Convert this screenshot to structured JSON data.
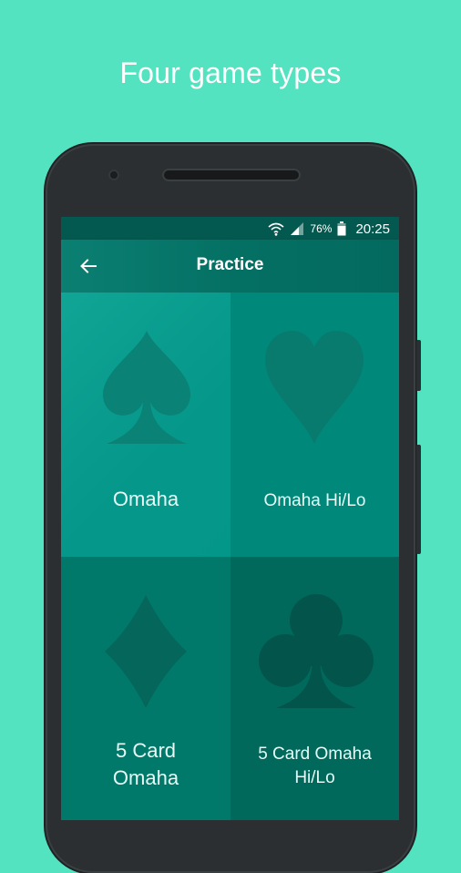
{
  "promo": {
    "headline": "Four game types"
  },
  "status_bar": {
    "battery_percent": "76%",
    "time": "20:25",
    "icons": [
      "wifi-icon",
      "cell-signal-icon",
      "battery-icon"
    ]
  },
  "app_bar": {
    "title": "Practice",
    "back_icon": "arrow-left-icon"
  },
  "games": [
    {
      "label": "Omaha",
      "icon": "spade-icon"
    },
    {
      "label": "Omaha Hi/Lo",
      "icon": "heart-icon"
    },
    {
      "label_line1": "5 Card",
      "label_line2": "Omaha",
      "icon": "diamond-icon"
    },
    {
      "label_line1": "5 Card Omaha",
      "label_line2": "Hi/Lo",
      "icon": "club-icon"
    }
  ],
  "colors": {
    "background": "#54e3c0",
    "status_bar": "#03584f",
    "tile_omaha": "#0a9b8c",
    "tile_hilo": "#00897b",
    "tile_5card": "#00796b",
    "tile_5card_hilo": "#00695c"
  }
}
